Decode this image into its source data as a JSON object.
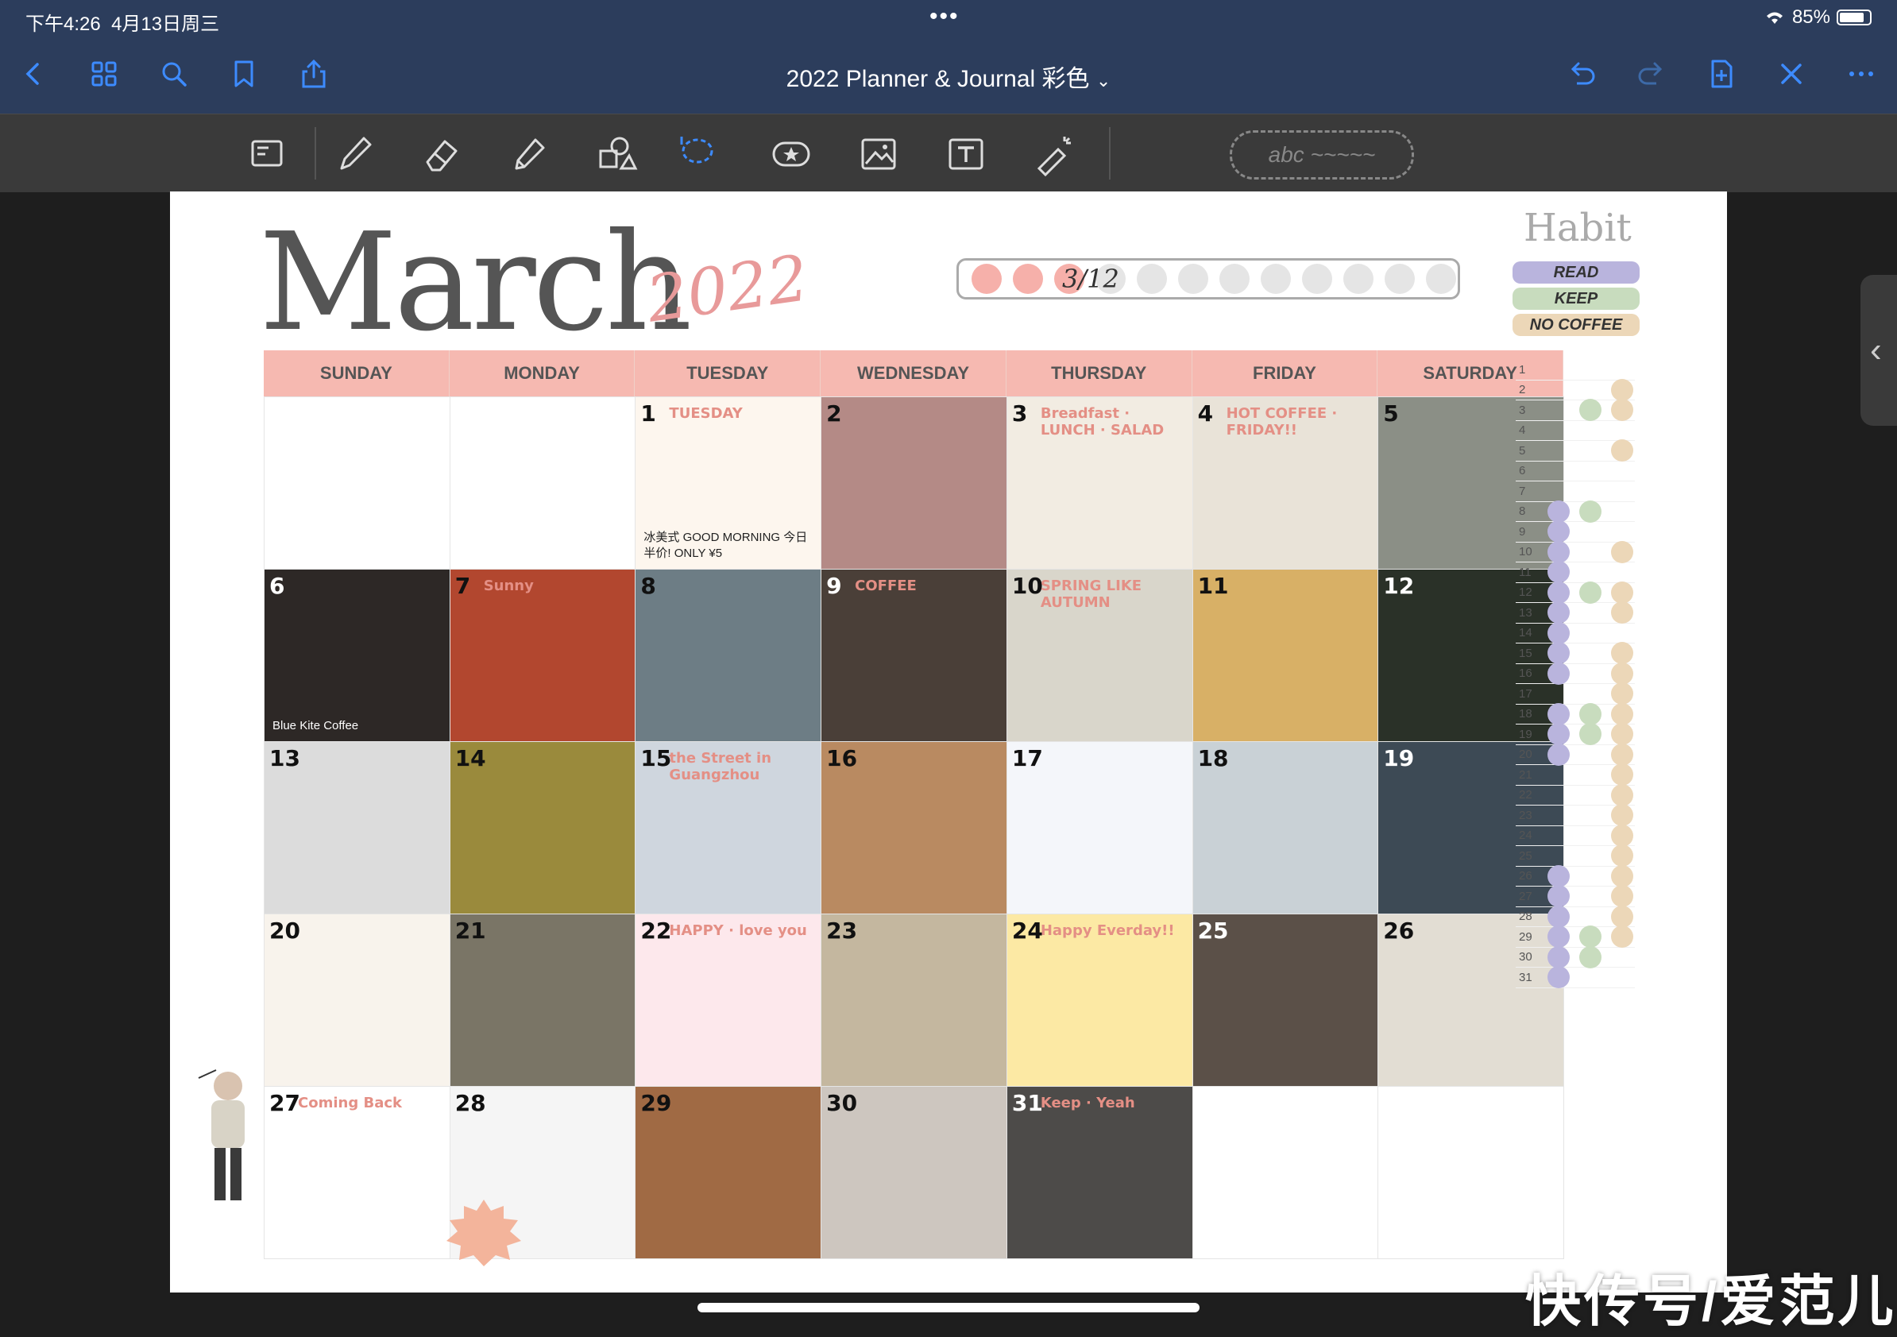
{
  "status_bar": {
    "time": "下午4:26",
    "date": "4月13日周三",
    "battery": "85%"
  },
  "title_bar": {
    "document_title": "2022 Planner & Journal 彩色"
  },
  "nav_icons": [
    "back-icon",
    "grid-icon",
    "search-icon",
    "bookmark-icon",
    "share-icon"
  ],
  "right_icons": [
    "undo-icon",
    "redo-icon",
    "add-page-icon",
    "close-icon",
    "more-icon"
  ],
  "tools": [
    "scan-icon",
    "pen-icon",
    "eraser-icon",
    "highlighter-icon",
    "shapes-icon",
    "lasso-icon",
    "sticker-icon",
    "image-icon",
    "text-icon",
    "laser-icon"
  ],
  "pen_preview": "abc ~~~~~",
  "page": {
    "month": "March",
    "year": "2022",
    "tracker_label": "3/12",
    "tracker_dots_on": 3,
    "tracker_dots_total": 12,
    "weekdays": [
      "SUNDAY",
      "MONDAY",
      "TUESDAY",
      "WEDNESDAY",
      "THURSDAY",
      "FRIDAY",
      "SATURDAY"
    ],
    "cells": [
      {
        "num": "",
        "bg": "#ffffff",
        "tag": "",
        "note": ""
      },
      {
        "num": "",
        "bg": "#ffffff",
        "tag": "",
        "note": ""
      },
      {
        "num": "1",
        "bg": "#fdf6ee",
        "tag": "TUESDAY",
        "note": "冰美式 GOOD MORNING 今日半价! ONLY ¥5"
      },
      {
        "num": "2",
        "bg": "#b48a86",
        "tag": "",
        "note": ""
      },
      {
        "num": "3",
        "bg": "#f2ece2",
        "tag": "Breadfast · LUNCH · SALAD",
        "note": ""
      },
      {
        "num": "4",
        "bg": "#e9e3d8",
        "tag": "HOT COFFEE · FRIDAY!!",
        "note": ""
      },
      {
        "num": "5",
        "bg": "#8b8f86",
        "tag": "",
        "note": ""
      },
      {
        "num": "6",
        "bg": "#2d2826",
        "tag": "",
        "note": "Blue Kite Coffee"
      },
      {
        "num": "7",
        "bg": "#b2472f",
        "tag": "Sunny",
        "note": ""
      },
      {
        "num": "8",
        "bg": "#6d7d85",
        "tag": "",
        "note": ""
      },
      {
        "num": "9",
        "bg": "#4a3f38",
        "tag": "COFFEE",
        "note": ""
      },
      {
        "num": "10",
        "bg": "#d9d6cb",
        "tag": "SPRING LIKE AUTUMN",
        "note": ""
      },
      {
        "num": "11",
        "bg": "#d8b066",
        "tag": "",
        "note": ""
      },
      {
        "num": "12",
        "bg": "#2a3128",
        "tag": "",
        "note": ""
      },
      {
        "num": "13",
        "bg": "#dcdcdc",
        "tag": "",
        "note": ""
      },
      {
        "num": "14",
        "bg": "#9a8a3c",
        "tag": "",
        "note": ""
      },
      {
        "num": "15",
        "bg": "#cfd6de",
        "tag": "the Street in Guangzhou",
        "note": ""
      },
      {
        "num": "16",
        "bg": "#b98a61",
        "tag": "",
        "note": ""
      },
      {
        "num": "17",
        "bg": "#f4f6fa",
        "tag": "",
        "note": ""
      },
      {
        "num": "18",
        "bg": "#c9d1d6",
        "tag": "",
        "note": ""
      },
      {
        "num": "19",
        "bg": "#3d4a55",
        "tag": "",
        "note": ""
      },
      {
        "num": "20",
        "bg": "#f8f3ec",
        "tag": "",
        "note": ""
      },
      {
        "num": "21",
        "bg": "#7a7566",
        "tag": "",
        "note": ""
      },
      {
        "num": "22",
        "bg": "#fde8ec",
        "tag": "HAPPY · love you",
        "note": ""
      },
      {
        "num": "23",
        "bg": "#c4b79f",
        "tag": "",
        "note": ""
      },
      {
        "num": "24",
        "bg": "#fce9a4",
        "tag": "Happy Everday!!",
        "note": ""
      },
      {
        "num": "25",
        "bg": "#5b5048",
        "tag": "",
        "note": ""
      },
      {
        "num": "26",
        "bg": "#e2ddd3",
        "tag": "",
        "note": ""
      },
      {
        "num": "27",
        "bg": "#ffffff",
        "tag": "Coming Back",
        "note": ""
      },
      {
        "num": "28",
        "bg": "#f5f5f5",
        "tag": "",
        "note": ""
      },
      {
        "num": "29",
        "bg": "#a06a44",
        "tag": "",
        "note": ""
      },
      {
        "num": "30",
        "bg": "#cdc6bf",
        "tag": "",
        "note": ""
      },
      {
        "num": "31",
        "bg": "#4d4b49",
        "tag": "Keep · Yeah",
        "note": ""
      },
      {
        "num": "",
        "bg": "#ffffff",
        "tag": "",
        "note": ""
      },
      {
        "num": "",
        "bg": "#ffffff",
        "tag": "",
        "note": ""
      }
    ],
    "habit": {
      "title": "Habit",
      "labels": [
        {
          "text": "READ",
          "color": "#b9b4dd"
        },
        {
          "text": "KEEP",
          "color": "#c8dcbe"
        },
        {
          "text": "NO COFFEE",
          "color": "#ecd7b8"
        }
      ],
      "days": [
        "1",
        "2",
        "3",
        "4",
        "5",
        "6",
        "7",
        "8",
        "9",
        "10",
        "11",
        "12",
        "13",
        "14",
        "15",
        "16",
        "17",
        "18",
        "19",
        "20",
        "21",
        "22",
        "23",
        "24",
        "25",
        "26",
        "27",
        "28",
        "29",
        "30",
        "31"
      ],
      "read": [
        8,
        9,
        10,
        11,
        12,
        13,
        14,
        15,
        16,
        18,
        19,
        20,
        26,
        27,
        28,
        29,
        30,
        31
      ],
      "keep": [
        3,
        8,
        12,
        18,
        19,
        29,
        30
      ],
      "nocoffee": [
        2,
        3,
        5,
        10,
        12,
        13,
        15,
        16,
        17,
        18,
        19,
        20,
        21,
        22,
        23,
        24,
        25,
        26,
        27,
        28,
        29
      ]
    }
  },
  "watermark": "快传号/爱范儿"
}
